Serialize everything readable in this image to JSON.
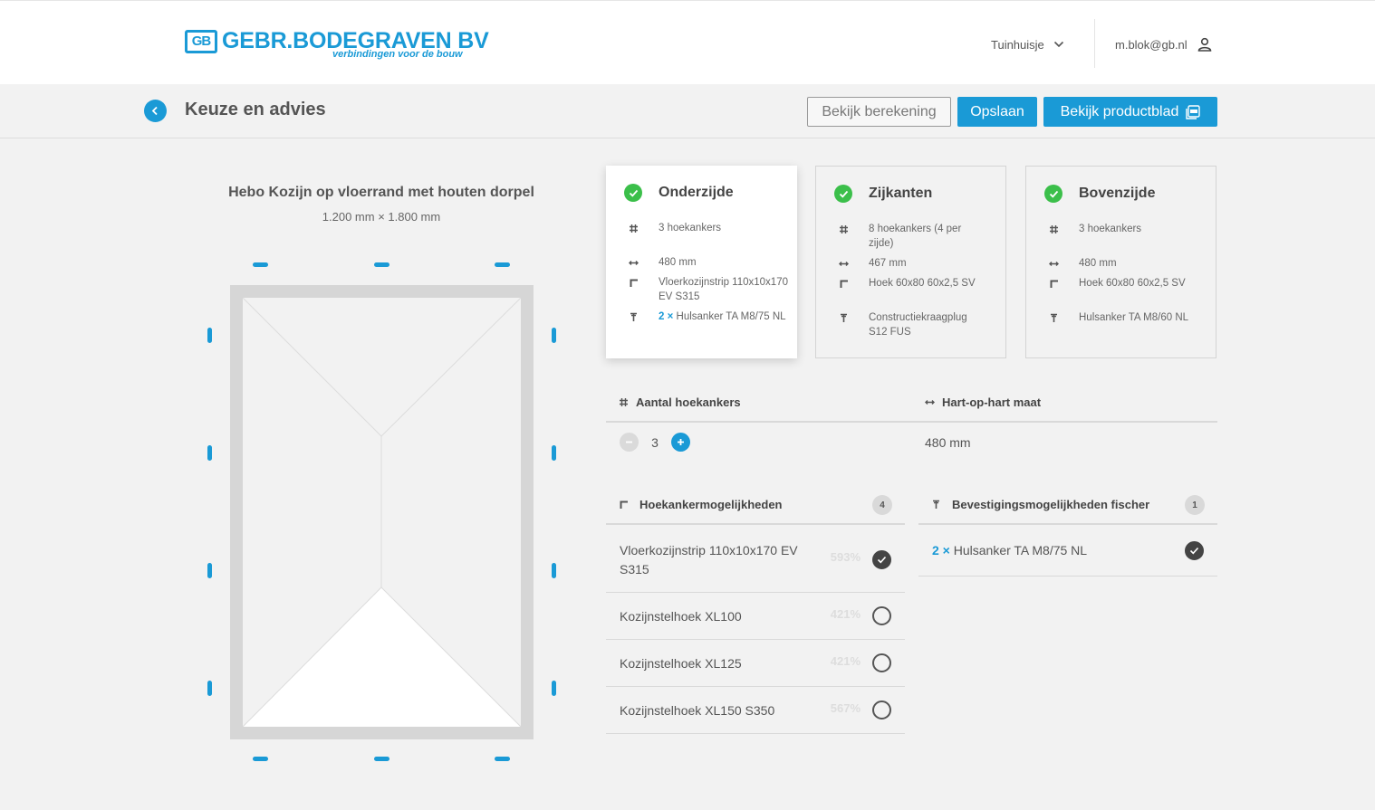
{
  "brand": {
    "badge": "GB",
    "name": "GEBR.BODEGRAVEN BV",
    "tagline": "verbindingen voor de bouw",
    "accent": "#1a9ad6"
  },
  "header": {
    "project": "Tuinhuisje",
    "user_email": "m.blok@gb.nl"
  },
  "toolbar": {
    "title": "Keuze en advies",
    "view_calc_label": "Bekijk berekening",
    "save_label": "Opslaan",
    "product_sheet_label": "Bekijk productblad"
  },
  "product": {
    "title": "Hebo Kozijn op vloerrand met houten dorpel",
    "dimensions": "1.200 mm × 1.800 mm"
  },
  "sides": [
    {
      "title": "Onderzijde",
      "anchors": "3 hoekankers",
      "spacing": "480 mm",
      "corner": "Vloerkozijnstrip 110x10x170 EV S315",
      "fixing_qty": "2 ×",
      "fixing": "Hulsanker TA M8/75 NL"
    },
    {
      "title": "Zijkanten",
      "anchors": "8 hoekankers (4 per zijde)",
      "spacing": "467 mm",
      "corner": "Hoek 60x80 60x2,5 SV",
      "fixing_qty": "",
      "fixing": "Constructiekraagplug S12 FUS"
    },
    {
      "title": "Bovenzijde",
      "anchors": "3 hoekankers",
      "spacing": "480 mm",
      "corner": "Hoek 60x80 60x2,5 SV",
      "fixing_qty": "",
      "fixing": "Hulsanker TA M8/60 NL"
    }
  ],
  "counts": {
    "anchors_label": "Aantal hoekankers",
    "spacing_label": "Hart-op-hart maat",
    "anchors_value": "3",
    "spacing_value": "480 mm"
  },
  "anchor_options": {
    "label": "Hoekankermogelijkheden",
    "count": "4",
    "items": [
      {
        "label": "Vloerkozijnstrip 110x10x170 EV S315",
        "pct": "593%",
        "selected": true
      },
      {
        "label": "Kozijnstelhoek XL100",
        "pct": "421%",
        "selected": false
      },
      {
        "label": "Kozijnstelhoek XL125",
        "pct": "421%",
        "selected": false
      },
      {
        "label": "Kozijnstelhoek XL150 S350",
        "pct": "567%",
        "selected": false
      }
    ]
  },
  "fixing_options": {
    "label": "Bevestigingsmogelijkheden fischer",
    "count": "1",
    "items": [
      {
        "qty": "2 ×",
        "label": "Hulsanker TA M8/75 NL",
        "selected": true
      }
    ]
  }
}
